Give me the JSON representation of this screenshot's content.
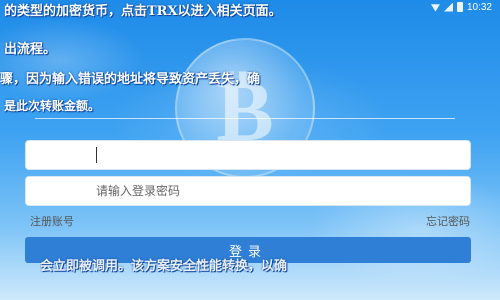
{
  "status_bar": {
    "time": "10:32"
  },
  "overlay": {
    "line1": "的类型的加密货币，点击TRX以进入相关页面。",
    "line2": "出流程。",
    "line3": "骤，因为输入错误的地址将导致资产丢失，确",
    "line4": "是此次转账金额。",
    "line5": "会立即被调用。该方案安全性能转换，以确"
  },
  "login": {
    "account_placeholder": "",
    "password_placeholder": "请输入登录密码",
    "register_link": "注册账号",
    "forgot_link": "忘记密码",
    "login_button": "登录"
  },
  "colors": {
    "primary": "#2f7fd6",
    "background": "#1e88e5"
  },
  "icons": {
    "coin": "bitcoin-icon"
  }
}
